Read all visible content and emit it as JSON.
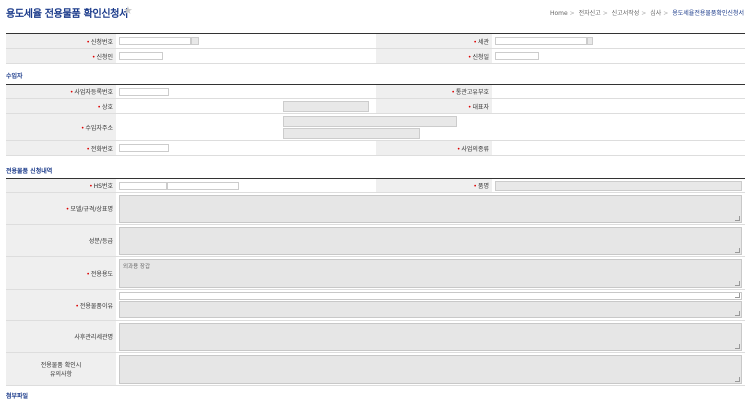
{
  "header": {
    "title": "용도세율 전용물품 확인신청서",
    "breadcrumb": [
      "Home",
      "전자신고",
      "신고서작성",
      "심사",
      "용도세율전용물품확인신청서"
    ]
  },
  "application": {
    "req_no_label": "신청번호",
    "customs_label": "세관",
    "applicant_label": "신청인",
    "date_label": "신청일"
  },
  "importer": {
    "section_title": "수입자",
    "reg_no_label": "사업자등록번호",
    "customs_id_label": "통관고유부호",
    "company_label": "상호",
    "ceo_label": "대표자",
    "address_label": "수입자주소",
    "phone_label": "전화번호",
    "biz_type_label": "사업의종류"
  },
  "goods": {
    "section_title": "전용물품 신청내역",
    "hs_label": "HS번호",
    "item_name_label": "품명",
    "model_label": "모델/규격/상표명",
    "composition_label": "성분/등급",
    "usage_label": "전용용도",
    "usage_value": "외과용 장갑",
    "reason_label": "전용물품이유",
    "mgmt_label": "사후관리세관명",
    "notes_label_line1": "전용물품 확인시",
    "notes_label_line2": "유의사항"
  },
  "attachment": {
    "section_title": "첨부파일"
  }
}
